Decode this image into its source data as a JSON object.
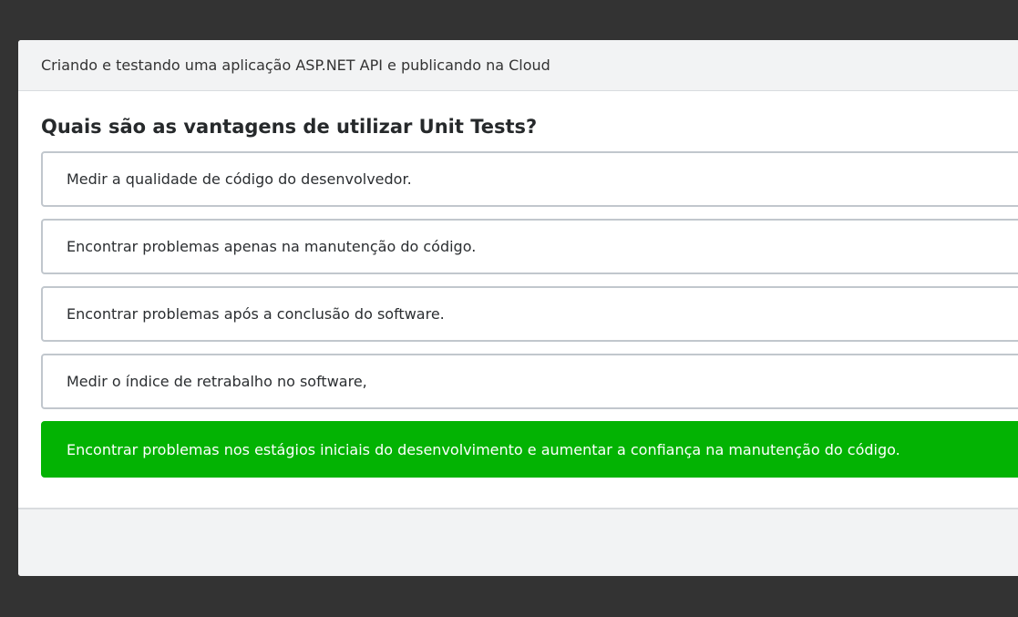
{
  "modal": {
    "header_title": "Criando e testando uma aplicação ASP.NET API e publicando na Cloud",
    "question": "Quais são as vantagens de utilizar Unit Tests?",
    "options": [
      {
        "label": "Medir a qualidade de código do desenvolvedor.",
        "state": "default"
      },
      {
        "label": "Encontrar problemas apenas na manutenção do código.",
        "state": "default"
      },
      {
        "label": "Encontrar problemas após a conclusão do software.",
        "state": "default"
      },
      {
        "label": "Medir o índice de retrabalho no software,",
        "state": "default"
      },
      {
        "label": "Encontrar problemas nos estágios iniciais do desenvolvimento e aumentar a confiança na manutenção do código.",
        "state": "correct"
      }
    ]
  },
  "colors": {
    "backdrop": "#333333",
    "header_bg": "#f2f3f4",
    "correct_green": "#03b303",
    "option_border": "#c1c7cd"
  }
}
